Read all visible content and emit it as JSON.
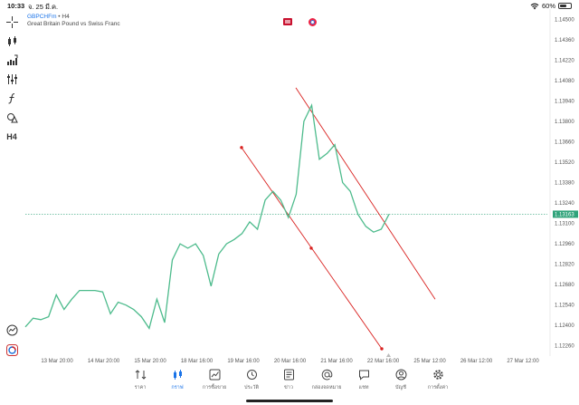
{
  "status_bar": {
    "time": "10:33",
    "date": "จ. 25 มี.ค.",
    "battery": "60%"
  },
  "symbol": {
    "name": "GBPCHFm",
    "timeframe": "H4",
    "separator": " • ",
    "description": "Great Britain Pound vs Swiss Franc"
  },
  "left_toolbar": {
    "timeframe_label": "H4"
  },
  "price_axis": {
    "labels": [
      "1.14500",
      "1.14360",
      "1.14220",
      "1.14080",
      "1.13940",
      "1.13800",
      "1.13660",
      "1.13520",
      "1.13380",
      "1.13240",
      "1.13100",
      "1.12960",
      "1.12820",
      "1.12680",
      "1.12540",
      "1.12400",
      "1.12260"
    ],
    "current_price": "1.13163"
  },
  "time_axis": {
    "labels": [
      "13 Mar 20:00",
      "14 Mar 20:00",
      "15 Mar 20:00",
      "18 Mar 16:00",
      "19 Mar 16:00",
      "20 Mar 16:00",
      "21 Mar 16:00",
      "22 Mar 16:00",
      "25 Mar 12:00",
      "26 Mar 12:00",
      "27 Mar 12:00"
    ]
  },
  "chart_data": {
    "type": "line",
    "series": [
      {
        "name": "GBPCHFm H4",
        "color": "#4dbb8c",
        "values": [
          1.1239,
          1.1245,
          1.1244,
          1.1246,
          1.1261,
          1.1251,
          1.1258,
          1.1264,
          1.1264,
          1.1264,
          1.1263,
          1.1248,
          1.1256,
          1.1254,
          1.1251,
          1.1246,
          1.1238,
          1.1258,
          1.1242,
          1.1285,
          1.1296,
          1.1293,
          1.1296,
          1.1288,
          1.1267,
          1.1289,
          1.1296,
          1.1299,
          1.1303,
          1.1311,
          1.1306,
          1.1326,
          1.1332,
          1.1326,
          1.1314,
          1.133,
          1.138,
          1.1391,
          1.1354,
          1.1358,
          1.1364,
          1.1338,
          1.1332,
          1.1316,
          1.1308,
          1.1304,
          1.1306,
          1.13163
        ]
      }
    ],
    "trendlines": {
      "color": "#d9211f",
      "upper": {
        "from": 1.1403,
        "to": 1.1258
      },
      "lower": {
        "from": 1.1362,
        "to": 1.1224
      }
    },
    "current_price": 1.13163,
    "ylim": [
      1.1219,
      1.1457
    ]
  },
  "bottom_nav": [
    {
      "key": "quotes",
      "label": "ราคา",
      "icon": "quotes-icon",
      "active": false
    },
    {
      "key": "chart",
      "label": "กราฟ",
      "icon": "candles-icon",
      "active": true
    },
    {
      "key": "trade",
      "label": "การซื้อขาย",
      "icon": "trade-icon",
      "active": false
    },
    {
      "key": "history",
      "label": "ประวัติ",
      "icon": "history-icon",
      "active": false
    },
    {
      "key": "news",
      "label": "ข่าว",
      "icon": "news-icon",
      "active": false
    },
    {
      "key": "mailbox",
      "label": "กล่องจดหมาย",
      "icon": "mail-icon",
      "active": false
    },
    {
      "key": "chat",
      "label": "แชท",
      "icon": "chat-icon",
      "active": false
    },
    {
      "key": "account",
      "label": "บัญชี",
      "icon": "account-icon",
      "active": false
    },
    {
      "key": "settings",
      "label": "การตั้งค่า",
      "icon": "gear-icon",
      "active": false
    }
  ]
}
